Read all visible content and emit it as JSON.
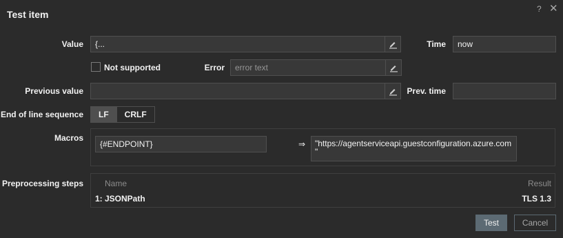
{
  "dialog": {
    "title": "Test item",
    "help_icon": "?",
    "close_icon": "✕"
  },
  "form": {
    "value": {
      "label": "Value",
      "value": "{..."
    },
    "time": {
      "label": "Time",
      "value": "now"
    },
    "not_supported": {
      "label": "Not supported",
      "checked": false
    },
    "error": {
      "label": "Error",
      "placeholder": "error text"
    },
    "previous_value": {
      "label": "Previous value",
      "value": ""
    },
    "prev_time": {
      "label": "Prev. time",
      "value": ""
    },
    "eol": {
      "label": "End of line sequence",
      "options": [
        "LF",
        "CRLF"
      ],
      "selected": "LF"
    },
    "macros": {
      "label": "Macros",
      "name": "{#ENDPOINT}",
      "arrow": "⇒",
      "value_line1": "\"https://agentserviceapi.guestconfiguration.azure.com",
      "value_line2": "\""
    },
    "preprocessing": {
      "label": "Preprocessing steps",
      "col_name": "Name",
      "col_result": "Result",
      "rows": [
        {
          "name": "1:  JSONPath",
          "result": "TLS 1.3"
        }
      ]
    }
  },
  "buttons": {
    "test": "Test",
    "cancel": "Cancel"
  },
  "icons": {
    "edit": "pencil-icon"
  }
}
